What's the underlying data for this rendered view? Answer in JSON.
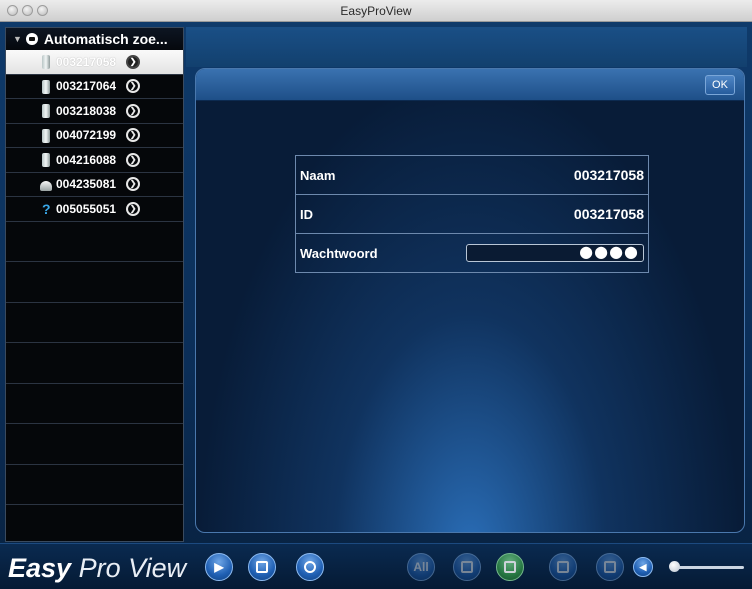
{
  "window": {
    "title": "EasyProView"
  },
  "sidebar": {
    "header": "Automatisch zoe...",
    "selected_index": 0,
    "devices": [
      {
        "label": "003217058",
        "icon": "camera-icon",
        "selected": true
      },
      {
        "label": "003217064",
        "icon": "camera-icon",
        "selected": false
      },
      {
        "label": "003218038",
        "icon": "camera-icon",
        "selected": false
      },
      {
        "label": "004072199",
        "icon": "camera-icon",
        "selected": false
      },
      {
        "label": "004216088",
        "icon": "camera-icon",
        "selected": false
      },
      {
        "label": "004235081",
        "icon": "dome-camera-icon",
        "selected": false
      },
      {
        "label": "005055051",
        "icon": "unknown-device-icon",
        "selected": false
      }
    ]
  },
  "dialog": {
    "ok_label": "OK",
    "fields": {
      "name": {
        "label": "Naam",
        "value": "003217058"
      },
      "id": {
        "label": "ID",
        "value": "003217058"
      },
      "password": {
        "label": "Wachtwoord",
        "value": "●●●●"
      }
    }
  },
  "toolbar": {
    "logo_bold": "Easy",
    "logo_light": "Pro View",
    "all_label": "All"
  },
  "colors": {
    "background": "#0b2e58",
    "sidebar": "#05070a",
    "accent": "#1f5fb3",
    "layout_active": "#2e8d43"
  }
}
